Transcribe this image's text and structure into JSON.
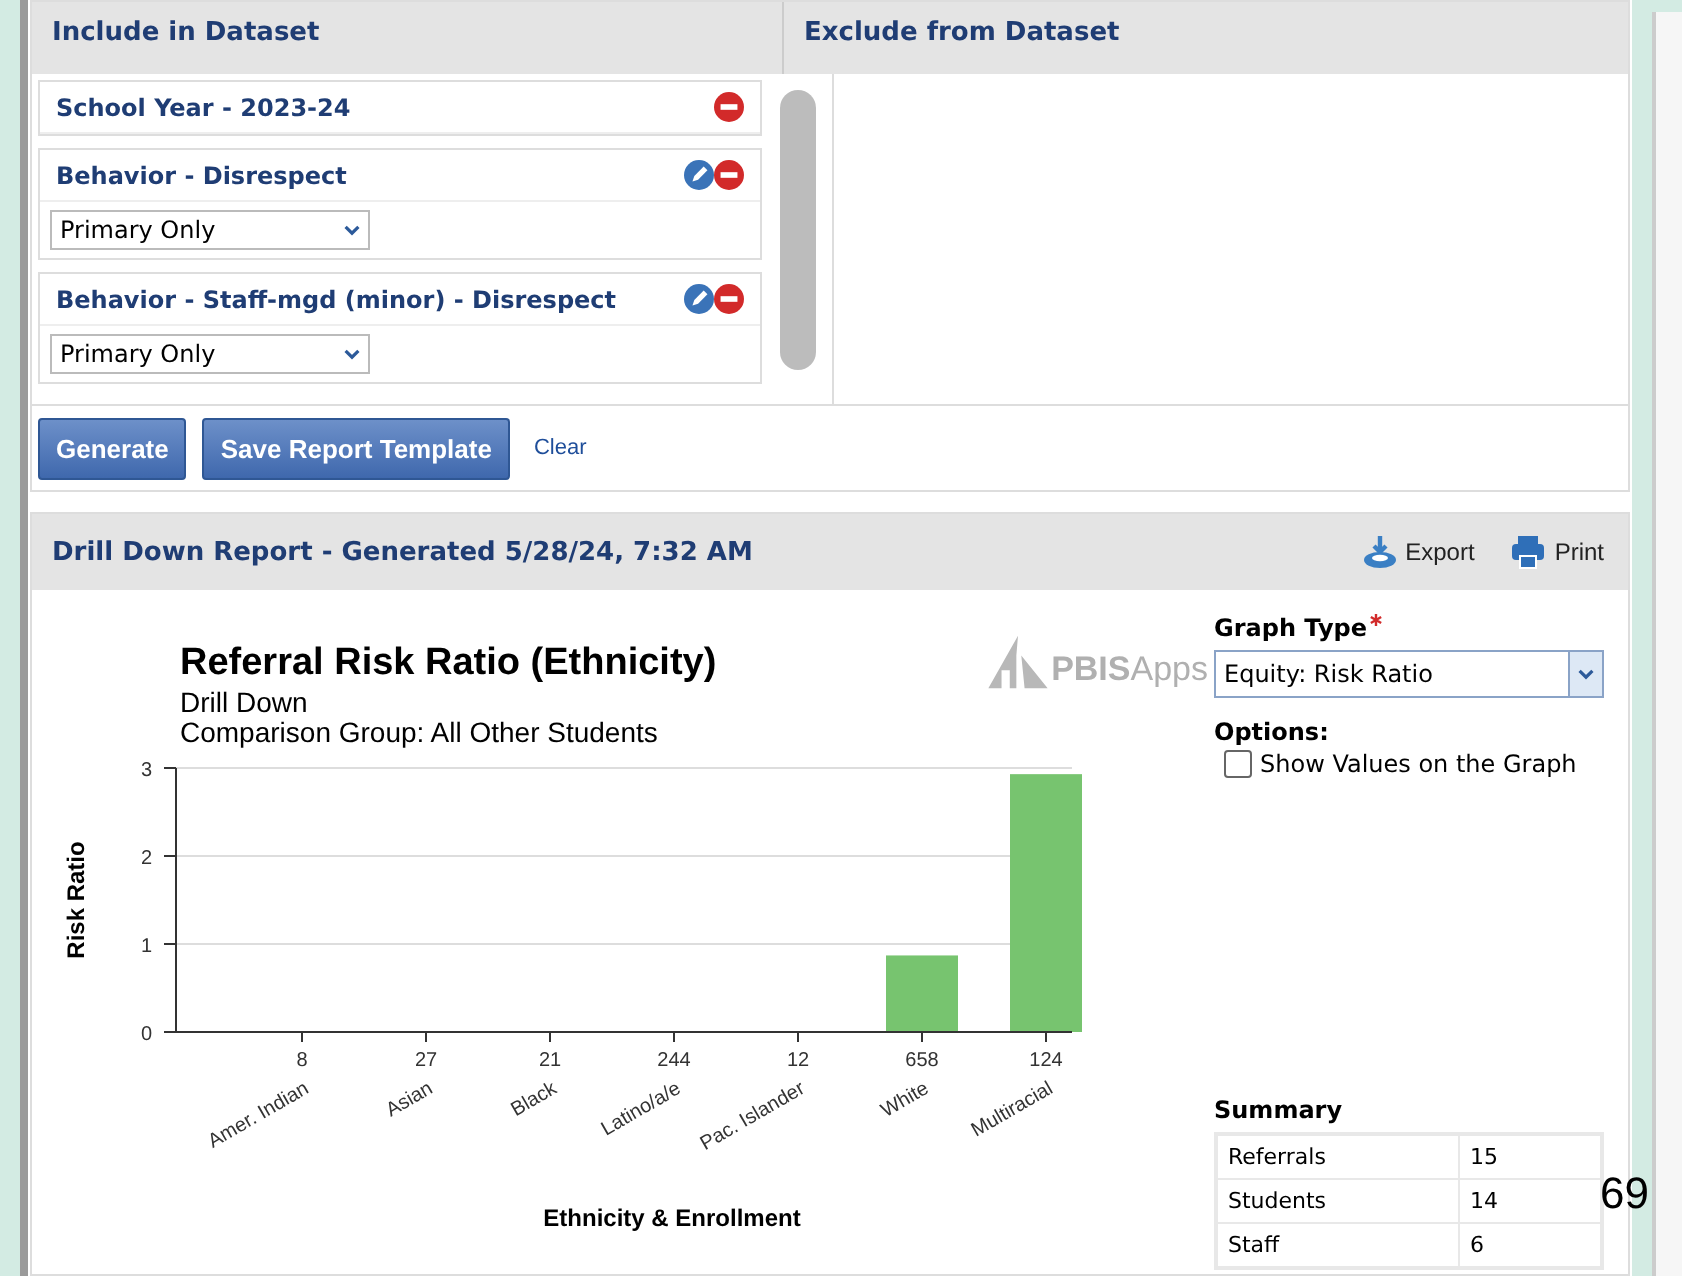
{
  "include": {
    "title": "Include in Dataset",
    "items": [
      {
        "title": "School Year - 2023-24",
        "editable": false
      },
      {
        "title": "Behavior - Disrespect",
        "editable": true,
        "select": "Primary Only"
      },
      {
        "title": "Behavior - Staff-mgd (minor) - Disrespect",
        "editable": true,
        "select": "Primary Only"
      }
    ]
  },
  "exclude": {
    "title": "Exclude from Dataset"
  },
  "buttons": [
    {
      "label": "Generate",
      "kind": "primary"
    },
    {
      "label": "Save Report Template",
      "kind": "primary"
    },
    {
      "label": "Clear",
      "kind": "link"
    }
  ],
  "report": {
    "title": "Drill Down Report - Generated 5/28/24, 7:32 AM",
    "actions": [
      {
        "label": "Export",
        "kind": "export"
      },
      {
        "label": "Print",
        "kind": "print"
      }
    ],
    "logo": {
      "bold": "PBIS",
      "light": "Apps"
    },
    "subtitle": [
      "Drill Down",
      "Comparison Group: All Other Students"
    ],
    "enrollment": [
      "8",
      "27",
      "21",
      "244",
      "12",
      "658",
      "124"
    ],
    "chart_data": {
      "type": "bar",
      "title": "Referral Risk Ratio (Ethnicity)",
      "xlabel": "Ethnicity & Enrollment",
      "ylabel": "Risk Ratio",
      "categories": [
        "Amer. Indian",
        "Asian",
        "Black",
        "Latino/a/e",
        "Pac. Islander",
        "White",
        "Multiracial"
      ],
      "series": [
        {
          "color": "#77c46f",
          "values": [
            0,
            0,
            0,
            0,
            0,
            0.87,
            2.93
          ]
        }
      ],
      "ylim": [
        0,
        3
      ],
      "yticks": [
        0,
        1,
        2,
        3
      ]
    },
    "graph_type": {
      "label": "Graph Type",
      "required": true,
      "value": "Equity: Risk Ratio"
    },
    "options": {
      "label": "Options:",
      "items": [
        {
          "label": "Show Values on the Graph",
          "checked": false
        }
      ]
    },
    "summary": {
      "title": "Summary",
      "rows": [
        [
          "Referrals",
          "15"
        ],
        [
          "Students",
          "14"
        ],
        [
          "Staff",
          "6"
        ]
      ]
    }
  },
  "page_number": "69"
}
